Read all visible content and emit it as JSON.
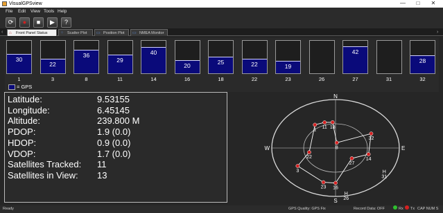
{
  "window": {
    "title": "VisualGPSview",
    "minimize": "—",
    "maximize": "□",
    "close": "✕"
  },
  "menu": [
    "File",
    "Edit",
    "View",
    "Tools",
    "Help"
  ],
  "toolbar": [
    {
      "name": "open-button",
      "glyph": "⟳",
      "icon": "refresh-icon"
    },
    {
      "name": "record-button",
      "glyph": "●",
      "icon": "record-icon",
      "color": "#d02020"
    },
    {
      "name": "stop-button",
      "glyph": "■",
      "icon": "stop-icon"
    },
    {
      "name": "play-button",
      "glyph": "▶",
      "icon": "play-icon"
    },
    {
      "name": "help-button",
      "glyph": "?",
      "icon": "help-icon"
    }
  ],
  "tabs": [
    {
      "label": "Front Panel Status",
      "active": true,
      "icon": "home-icon"
    },
    {
      "label": "Scatter Plot",
      "active": false,
      "icon": "scatter-icon"
    },
    {
      "label": "Position Plot",
      "active": false,
      "icon": "position-icon"
    },
    {
      "label": "NMEA Monitor",
      "active": false,
      "icon": "monitor-icon"
    }
  ],
  "signal": {
    "max_snr": 50,
    "bars": [
      {
        "prn": "1",
        "snr": 30
      },
      {
        "prn": "3",
        "snr": 22
      },
      {
        "prn": "8",
        "snr": 36
      },
      {
        "prn": "11",
        "snr": 29
      },
      {
        "prn": "14",
        "snr": 40
      },
      {
        "prn": "16",
        "snr": 20
      },
      {
        "prn": "18",
        "snr": 25
      },
      {
        "prn": "22",
        "snr": 22
      },
      {
        "prn": "23",
        "snr": 19
      },
      {
        "prn": "26",
        "snr": null
      },
      {
        "prn": "27",
        "snr": 42
      },
      {
        "prn": "31",
        "snr": null
      },
      {
        "prn": "32",
        "snr": 28
      }
    ],
    "legend": "= GPS",
    "bar_color": "#0a0a7a"
  },
  "position": {
    "rows": [
      {
        "label": "Latitude:",
        "value": "9.53155"
      },
      {
        "label": "Longitude:",
        "value": "6.45145"
      },
      {
        "label": "Altitude:",
        "value": "239.800 M"
      },
      {
        "label": "PDOP:",
        "value": "1.9 (0.0)"
      },
      {
        "label": "HDOP:",
        "value": "0.9 (0.0)"
      },
      {
        "label": "VDOP:",
        "value": "1.7 (0.0)"
      },
      {
        "label": "Satellites Tracked:",
        "value": "11"
      },
      {
        "label": "Satellites in View:",
        "value": "13"
      }
    ]
  },
  "skyplot": {
    "compass": {
      "north": "N",
      "east": "E",
      "south": "S",
      "west": "W"
    },
    "satellites": [
      {
        "prn": "1",
        "az": 326,
        "el": 38,
        "tracked": true
      },
      {
        "prn": "11",
        "az": 342,
        "el": 40,
        "tracked": true
      },
      {
        "prn": "18",
        "az": 355,
        "el": 42,
        "tracked": true
      },
      {
        "prn": "8",
        "az": 10,
        "el": 80,
        "tracked": true
      },
      {
        "prn": "32",
        "az": 62,
        "el": 33,
        "tracked": true
      },
      {
        "prn": "14",
        "az": 104,
        "el": 42,
        "tracked": true
      },
      {
        "prn": "27",
        "az": 130,
        "el": 60,
        "tracked": true
      },
      {
        "prn": "16",
        "az": 180,
        "el": 25,
        "tracked": true
      },
      {
        "prn": "23",
        "az": 195,
        "el": 24,
        "tracked": true
      },
      {
        "prn": "22",
        "az": 258,
        "el": 52,
        "tracked": true
      },
      {
        "prn": "3",
        "az": 238,
        "el": 27,
        "tracked": true
      },
      {
        "prn": "26",
        "az": 170,
        "el": 4,
        "tracked": false
      },
      {
        "prn": "31",
        "az": 123,
        "el": 8,
        "tracked": false
      }
    ],
    "constellation_order": [
      "18",
      "11",
      "1",
      "22",
      "3",
      "23",
      "16",
      "27",
      "14",
      "32",
      "8",
      "18"
    ],
    "sat_color": "#d42020"
  },
  "status": {
    "left": "Ready",
    "quality": "GPS Quality: GPS Fix",
    "record": "Record Data: OFF",
    "rx": "Rx",
    "tx": "Tx",
    "mode": "CAP NUM S"
  }
}
